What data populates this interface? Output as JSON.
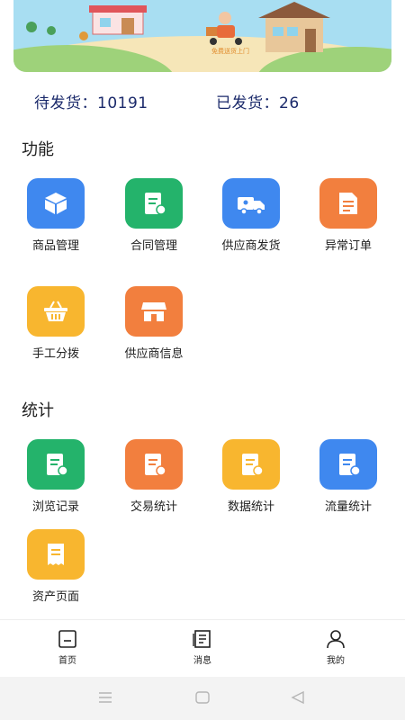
{
  "banner": {
    "caption": "免费送货上门"
  },
  "status": {
    "pending_label": "待发货：",
    "pending_count": "10191",
    "shipped_label": "已发货：",
    "shipped_count": "26"
  },
  "sections": {
    "functions": {
      "title": "功能",
      "items": [
        {
          "label": "商品管理",
          "icon": "box-icon",
          "color": "#3f88ef"
        },
        {
          "label": "合同管理",
          "icon": "contract-icon",
          "color": "#24b36b"
        },
        {
          "label": "供应商发货",
          "icon": "truck-icon",
          "color": "#3f88ef"
        },
        {
          "label": "异常订单",
          "icon": "document-icon",
          "color": "#f27f3e"
        },
        {
          "label": "手工分拨",
          "icon": "basket-icon",
          "color": "#f8b62f"
        },
        {
          "label": "供应商信息",
          "icon": "store-icon",
          "color": "#f27f3e"
        }
      ]
    },
    "statistics": {
      "title": "统计",
      "items": [
        {
          "label": "浏览记录",
          "icon": "report-icon",
          "color": "#24b36b"
        },
        {
          "label": "交易统计",
          "icon": "report-icon",
          "color": "#f27f3e"
        },
        {
          "label": "数据统计",
          "icon": "report-icon",
          "color": "#f8b62f"
        },
        {
          "label": "流量统计",
          "icon": "report-icon",
          "color": "#3f88ef"
        },
        {
          "label": "资产页面",
          "icon": "receipt-icon",
          "color": "#f8b62f"
        }
      ]
    }
  },
  "nav": {
    "items": [
      {
        "label": "首页",
        "icon": "home-icon"
      },
      {
        "label": "消息",
        "icon": "message-icon"
      },
      {
        "label": "我的",
        "icon": "user-icon"
      }
    ]
  },
  "system_bar": {
    "buttons": [
      "menu-icon",
      "home-square-icon",
      "back-triangle-icon"
    ]
  }
}
